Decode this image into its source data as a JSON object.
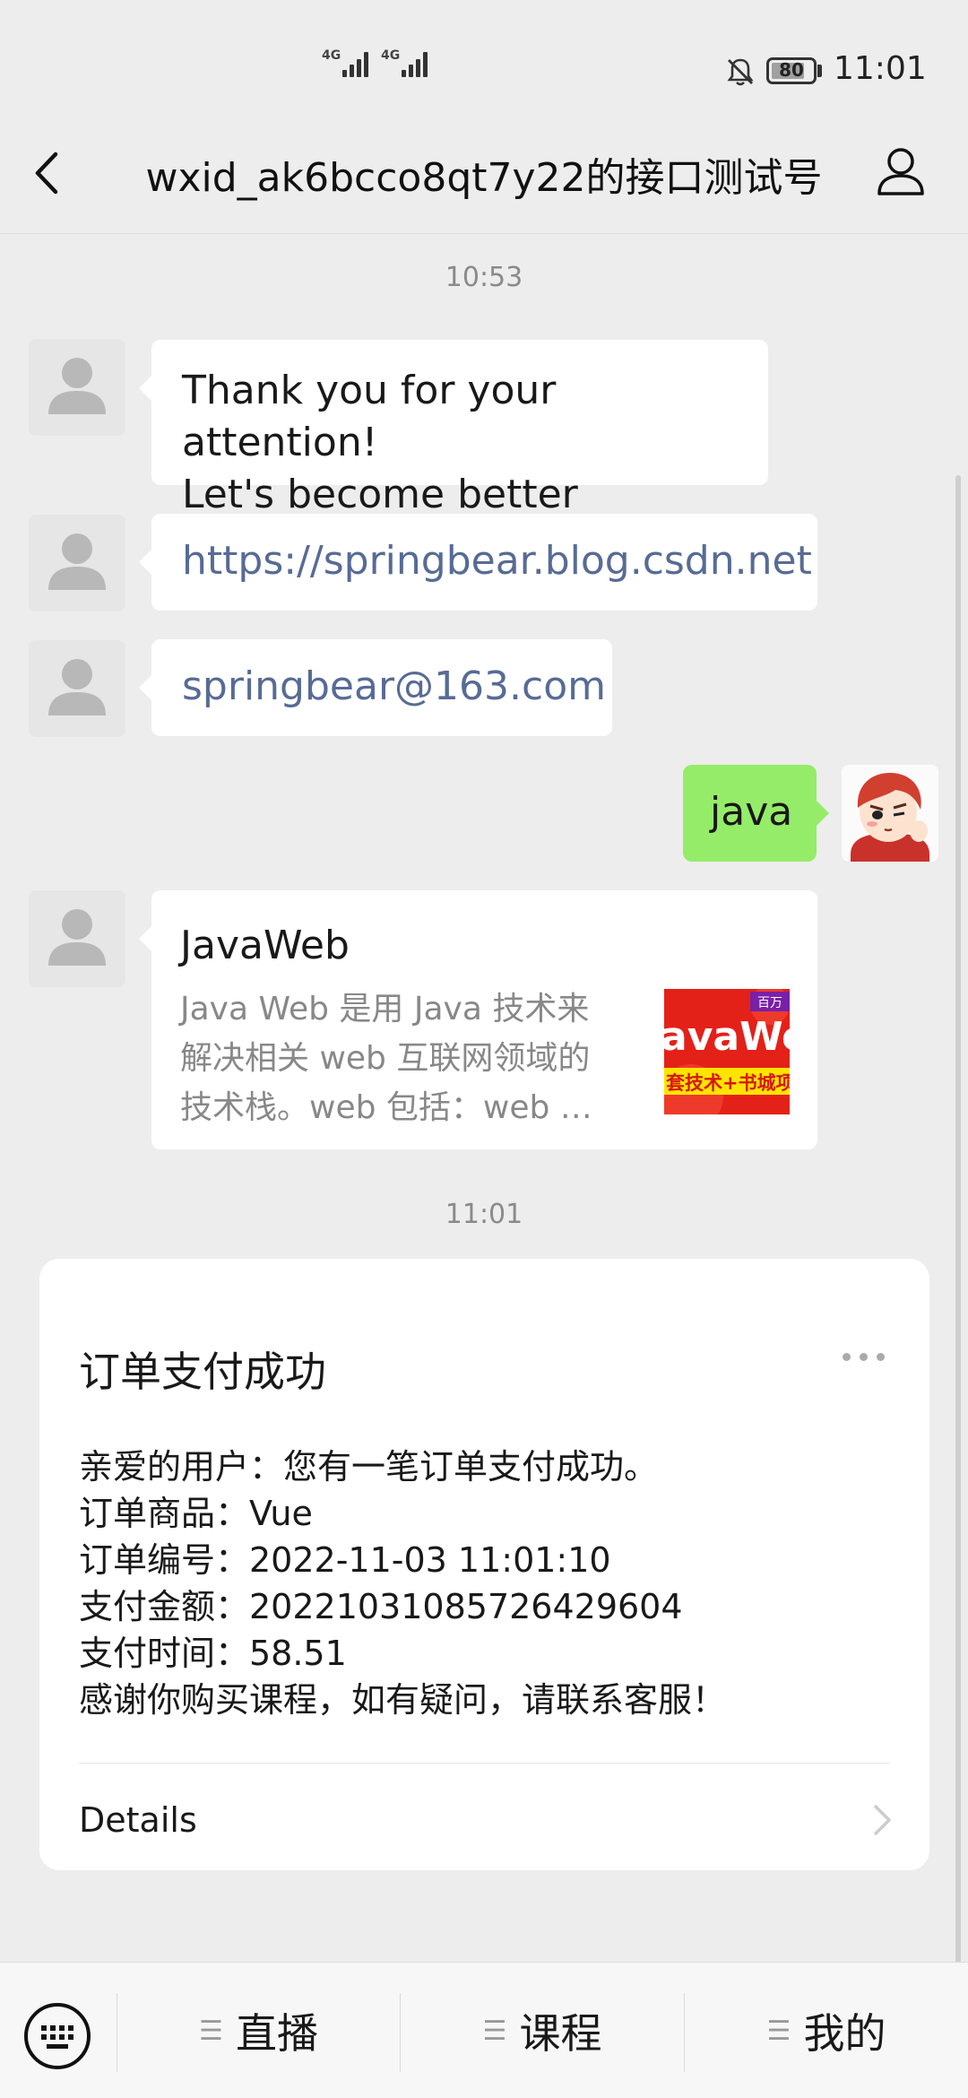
{
  "status_bar": {
    "network_1": "4G",
    "network_2": "4G",
    "battery_level": "80",
    "time": "11:01"
  },
  "nav": {
    "title": "wxid_ak6bcco8qt7y22的接口测试号"
  },
  "messages": {
    "time_1": "10:53",
    "msg_welcome": "Thank you for your attention!\nLet's become better together!",
    "msg_blog": "https://springbear.blog.csdn.net",
    "msg_email": "springbear@163.com",
    "msg_self": "java",
    "article": {
      "title": "JavaWeb",
      "description": "Java Web 是用 Java 技术来解决相关 web 互联网领域的技术栈。web 包括：web …",
      "thumb_badge": "百万",
      "thumb_line1": "avaWe",
      "thumb_line2": "套技术+书城项"
    },
    "time_2": "11:01"
  },
  "template_card": {
    "title": "订单支付成功",
    "lines": [
      "亲爱的用户：您有一笔订单支付成功。",
      "订单商品：Vue",
      "订单编号：2022-11-03 11:01:10",
      "支付金额：20221031085726429604",
      "支付时间：58.51",
      "感谢你购买课程，如有疑问，请联系客服！"
    ],
    "details_label": "Details"
  },
  "bottom_menu": {
    "items": [
      {
        "label": "直播"
      },
      {
        "label": "课程"
      },
      {
        "label": "我的"
      }
    ]
  },
  "colors": {
    "background": "#ededed",
    "bubble_self": "#95ec69",
    "link": "#576b95"
  }
}
